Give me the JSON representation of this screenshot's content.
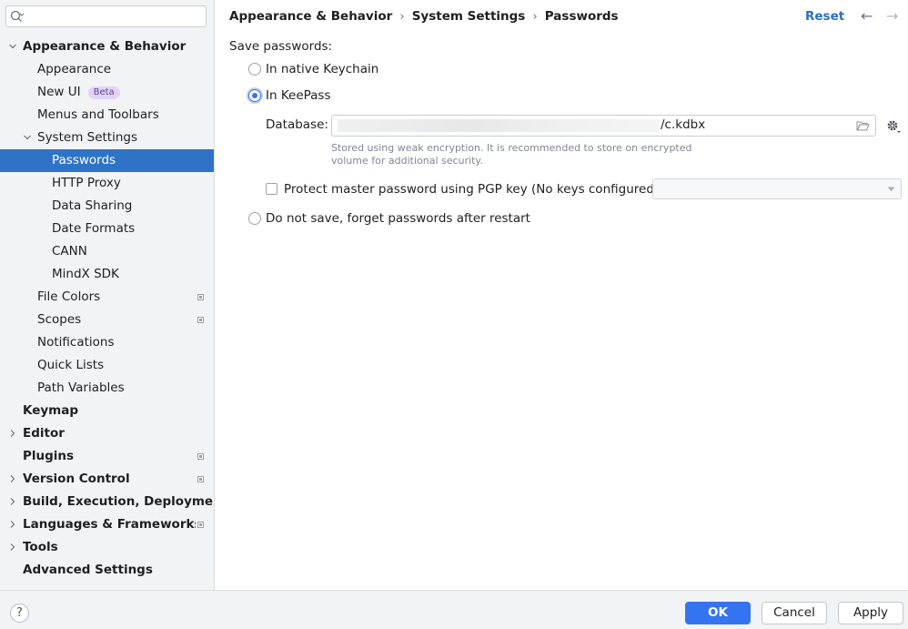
{
  "search": {
    "value": "",
    "placeholder": ""
  },
  "sidebar": {
    "items": [
      {
        "label": "Appearance & Behavior",
        "bold": true,
        "expanded": true
      },
      {
        "label": "Appearance"
      },
      {
        "label": "New UI",
        "badge": "Beta"
      },
      {
        "label": "Menus and Toolbars"
      },
      {
        "label": "System Settings",
        "expanded": true
      },
      {
        "label": "Passwords",
        "selected": true
      },
      {
        "label": "HTTP Proxy"
      },
      {
        "label": "Data Sharing"
      },
      {
        "label": "Date Formats"
      },
      {
        "label": "CANN"
      },
      {
        "label": "MindX SDK"
      },
      {
        "label": "File Colors"
      },
      {
        "label": "Scopes"
      },
      {
        "label": "Notifications"
      },
      {
        "label": "Quick Lists"
      },
      {
        "label": "Path Variables"
      },
      {
        "label": "Keymap",
        "bold": true
      },
      {
        "label": "Editor",
        "bold": true,
        "expanded": false
      },
      {
        "label": "Plugins",
        "bold": true
      },
      {
        "label": "Version Control",
        "bold": true,
        "expanded": false
      },
      {
        "label": "Build, Execution, Deployme",
        "bold": true,
        "expanded": false
      },
      {
        "label": "Languages & Frameworks",
        "bold": true,
        "expanded": false
      },
      {
        "label": "Tools",
        "bold": true,
        "expanded": false
      },
      {
        "label": "Advanced Settings",
        "bold": true
      }
    ]
  },
  "breadcrumb": {
    "parts": [
      "Appearance & Behavior",
      "System Settings",
      "Passwords"
    ],
    "separator": "›"
  },
  "header": {
    "reset_label": "Reset"
  },
  "passwords": {
    "save_label": "Save passwords:",
    "option_keychain": "In native Keychain",
    "option_keepass": "In KeePass",
    "selected_option": "In KeePass",
    "database_label": "Database:",
    "database_value_visible": "/c.kdbx",
    "hint": "Stored using weak encryption. It is recommended to store on encrypted volume for additional security.",
    "pgp_label": "Protect master password using PGP key (No keys configured)",
    "pgp_checked": false,
    "pgp_select_value": "",
    "option_no_save": "Do not save, forget passwords after restart"
  },
  "footer": {
    "help_label": "?",
    "ok_label": "OK",
    "cancel_label": "Cancel",
    "apply_label": "Apply"
  },
  "colors": {
    "accent": "#3574f0",
    "selection": "#2f73c7",
    "link": "#2a6fbf",
    "sidebar_bg": "#f2f3f5"
  }
}
